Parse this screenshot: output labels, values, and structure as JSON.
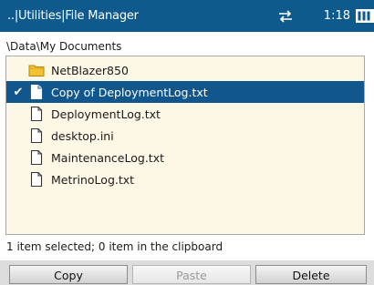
{
  "titlebar": {
    "title": "..|Utilities|File Manager",
    "time": "1:18",
    "sync_icon": "sync-arrows-icon",
    "battery_icon": "battery-icon"
  },
  "path": "\\Data\\My Documents",
  "files": [
    {
      "name": "NetBlazer850",
      "type": "folder",
      "selected": false
    },
    {
      "name": "Copy of DeploymentLog.txt",
      "type": "file",
      "selected": true
    },
    {
      "name": "DeploymentLog.txt",
      "type": "file",
      "selected": false
    },
    {
      "name": "desktop.ini",
      "type": "file",
      "selected": false
    },
    {
      "name": "MaintenanceLog.txt",
      "type": "file",
      "selected": false
    },
    {
      "name": "MetrinoLog.txt",
      "type": "file",
      "selected": false
    }
  ],
  "selection_info": "1 item selected; 0 item in the clipboard",
  "buttons": {
    "copy": "Copy",
    "paste": "Paste",
    "delete": "Delete"
  },
  "colors": {
    "titlebar": "#0e5a8c",
    "selected_row": "#11578d",
    "list_background": "#fdf8e6",
    "folder": "#f2c230"
  }
}
